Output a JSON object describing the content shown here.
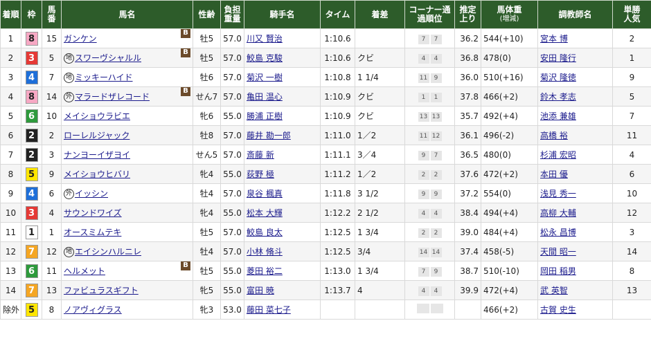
{
  "headers": {
    "rank": "着順",
    "waku": "枠",
    "num": "馬番",
    "horse": "馬名",
    "sexage": "性齢",
    "weight_carried": "負担重量",
    "jockey": "騎手名",
    "time": "タイム",
    "margin": "着差",
    "corner": "コーナー通過順位",
    "last3f": "推定上り",
    "body_weight": "馬体重",
    "body_weight_sub": "(増減)",
    "trainer": "調教師名",
    "pop": "単勝人気"
  },
  "colors": {
    "header_bg": "#2d5c2a",
    "waku_1": "#ffffff",
    "waku_2": "#222222",
    "waku_3": "#e53935",
    "waku_4": "#1e6fd9",
    "waku_5": "#ffe600",
    "waku_6": "#2e9a3c",
    "waku_7": "#f5a623",
    "waku_8": "#f7a8c4",
    "link": "#1a1a8c"
  },
  "rows": [
    {
      "rank": "1",
      "waku": "8",
      "num": "15",
      "mark": "",
      "horse": "ガンケン",
      "blinker": "B",
      "sexage": "牡5",
      "wt": "57.0",
      "jockey": "川又 賢治",
      "time": "1:10.6",
      "margin": "",
      "corner": [
        "7",
        "7"
      ],
      "last3f": "36.2",
      "bw": "544",
      "bwd": "(+10)",
      "trainer": "宮本 博",
      "pop": "2"
    },
    {
      "rank": "2",
      "waku": "3",
      "num": "5",
      "mark": "地",
      "horse": "スワーヴシャルル",
      "blinker": "B",
      "sexage": "牡5",
      "wt": "57.0",
      "jockey": "鮫島 克駿",
      "time": "1:10.6",
      "margin": "クビ",
      "corner": [
        "4",
        "4"
      ],
      "last3f": "36.8",
      "bw": "478",
      "bwd": "(0)",
      "trainer": "安田 隆行",
      "pop": "1"
    },
    {
      "rank": "3",
      "waku": "4",
      "num": "7",
      "mark": "地",
      "horse": "ミッキーハイド",
      "blinker": "",
      "sexage": "牡6",
      "wt": "57.0",
      "jockey": "菊沢 一樹",
      "time": "1:10.8",
      "margin": "1 1/4",
      "corner": [
        "11",
        "9"
      ],
      "last3f": "36.0",
      "bw": "510",
      "bwd": "(+16)",
      "trainer": "菊沢 隆徳",
      "pop": "9"
    },
    {
      "rank": "4",
      "waku": "8",
      "num": "14",
      "mark": "外",
      "horse": "マラードザレコード",
      "blinker": "B",
      "sexage": "せん7",
      "wt": "57.0",
      "jockey": "亀田 温心",
      "time": "1:10.9",
      "margin": "クビ",
      "corner": [
        "1",
        "1"
      ],
      "last3f": "37.8",
      "bw": "466",
      "bwd": "(+2)",
      "trainer": "鈴木 孝志",
      "pop": "5"
    },
    {
      "rank": "5",
      "waku": "6",
      "num": "10",
      "mark": "",
      "horse": "メイショウラビエ",
      "blinker": "",
      "sexage": "牝6",
      "wt": "55.0",
      "jockey": "勝浦 正樹",
      "time": "1:10.9",
      "margin": "クビ",
      "corner": [
        "13",
        "13"
      ],
      "last3f": "35.7",
      "bw": "492",
      "bwd": "(+4)",
      "trainer": "池添 兼雄",
      "pop": "7"
    },
    {
      "rank": "6",
      "waku": "2",
      "num": "2",
      "mark": "",
      "horse": "ローレルジャック",
      "blinker": "",
      "sexage": "牡8",
      "wt": "57.0",
      "jockey": "藤井 勘一郎",
      "time": "1:11.0",
      "margin": "1／2",
      "corner": [
        "11",
        "12"
      ],
      "last3f": "36.1",
      "bw": "496",
      "bwd": "(-2)",
      "trainer": "高橋 裕",
      "pop": "11"
    },
    {
      "rank": "7",
      "waku": "2",
      "num": "3",
      "mark": "",
      "horse": "ナンヨーイザヨイ",
      "blinker": "",
      "sexage": "せん5",
      "wt": "57.0",
      "jockey": "斎藤 新",
      "time": "1:11.1",
      "margin": "3／4",
      "corner": [
        "9",
        "7"
      ],
      "last3f": "36.5",
      "bw": "480",
      "bwd": "(0)",
      "trainer": "杉浦 宏昭",
      "pop": "4"
    },
    {
      "rank": "8",
      "waku": "5",
      "num": "9",
      "mark": "",
      "horse": "メイショウヒバリ",
      "blinker": "",
      "sexage": "牝4",
      "wt": "55.0",
      "jockey": "荻野 極",
      "time": "1:11.2",
      "margin": "1／2",
      "corner": [
        "2",
        "2"
      ],
      "last3f": "37.6",
      "bw": "472",
      "bwd": "(+2)",
      "trainer": "本田 優",
      "pop": "6"
    },
    {
      "rank": "9",
      "waku": "4",
      "num": "6",
      "mark": "外",
      "horse": "イッシン",
      "blinker": "",
      "sexage": "牡4",
      "wt": "57.0",
      "jockey": "泉谷 楓真",
      "time": "1:11.8",
      "margin": "3 1/2",
      "corner": [
        "9",
        "9"
      ],
      "last3f": "37.2",
      "bw": "554",
      "bwd": "(0)",
      "trainer": "浅見 秀一",
      "pop": "10"
    },
    {
      "rank": "10",
      "waku": "3",
      "num": "4",
      "mark": "",
      "horse": "サウンドワイズ",
      "blinker": "",
      "sexage": "牝4",
      "wt": "55.0",
      "jockey": "松本 大輝",
      "time": "1:12.2",
      "margin": "2 1/2",
      "corner": [
        "4",
        "4"
      ],
      "last3f": "38.4",
      "bw": "494",
      "bwd": "(+4)",
      "trainer": "高柳 大輔",
      "pop": "12"
    },
    {
      "rank": "11",
      "waku": "1",
      "num": "1",
      "mark": "",
      "horse": "オースミムテキ",
      "blinker": "",
      "sexage": "牡5",
      "wt": "57.0",
      "jockey": "鮫島 良太",
      "time": "1:12.5",
      "margin": "1 3/4",
      "corner": [
        "2",
        "2"
      ],
      "last3f": "39.0",
      "bw": "484",
      "bwd": "(+4)",
      "trainer": "松永 昌博",
      "pop": "3"
    },
    {
      "rank": "12",
      "waku": "7",
      "num": "12",
      "mark": "地",
      "horse": "エイシンハルニレ",
      "blinker": "",
      "sexage": "牡4",
      "wt": "57.0",
      "jockey": "小林 脩斗",
      "time": "1:12.5",
      "margin": "3/4",
      "corner": [
        "14",
        "14"
      ],
      "last3f": "37.4",
      "bw": "458",
      "bwd": "(-5)",
      "trainer": "天間 昭一",
      "pop": "14"
    },
    {
      "rank": "13",
      "waku": "6",
      "num": "11",
      "mark": "",
      "horse": "ヘルメット",
      "blinker": "B",
      "sexage": "牡5",
      "wt": "55.0",
      "jockey": "菱田 裕二",
      "time": "1:13.0",
      "margin": "1 3/4",
      "corner": [
        "7",
        "9"
      ],
      "last3f": "38.7",
      "bw": "510",
      "bwd": "(-10)",
      "trainer": "岡田 稲男",
      "pop": "8"
    },
    {
      "rank": "14",
      "waku": "7",
      "num": "13",
      "mark": "",
      "horse": "ファビュラスギフト",
      "blinker": "",
      "sexage": "牝5",
      "wt": "55.0",
      "jockey": "富田 暁",
      "time": "1:13.7",
      "margin": "4",
      "corner": [
        "4",
        "4"
      ],
      "last3f": "39.9",
      "bw": "472",
      "bwd": "(+4)",
      "trainer": "武 英智",
      "pop": "13"
    },
    {
      "rank": "除外",
      "waku": "5",
      "num": "8",
      "mark": "",
      "horse": "ノアヴィグラス",
      "blinker": "",
      "sexage": "牝3",
      "wt": "53.0",
      "jockey": "藤田 菜七子",
      "time": "",
      "margin": "",
      "corner": [
        "",
        ""
      ],
      "last3f": "",
      "bw": "466",
      "bwd": "(+2)",
      "trainer": "古賀 史生",
      "pop": ""
    }
  ]
}
